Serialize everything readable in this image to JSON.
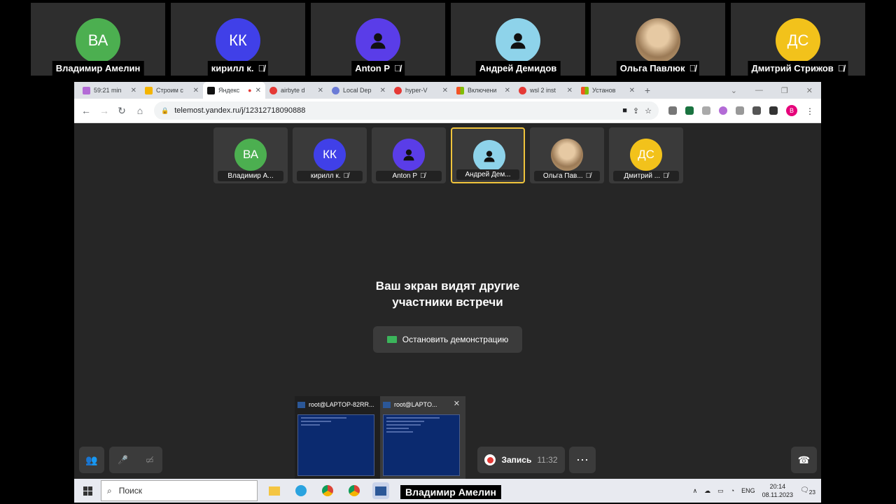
{
  "top_participants": [
    {
      "initials": "ВА",
      "name": "Владимир Амелин",
      "color": "#4caf50",
      "muted": false
    },
    {
      "initials": "КК",
      "name": "кирилл к.",
      "color": "#4040e8",
      "muted": true
    },
    {
      "initials": "",
      "name": "Anton P",
      "color": "#5a3de8",
      "muted": true,
      "icon": "person-icon"
    },
    {
      "initials": "",
      "name": "Андрей Демидов",
      "color": "#8ed3ea",
      "muted": false,
      "icon": "person-icon"
    },
    {
      "initials": "",
      "name": "Ольга Павлюк",
      "color": "#c8a77a",
      "muted": true,
      "icon": "photo-avatar"
    },
    {
      "initials": "ДС",
      "name": "Дмитрий Стрижов",
      "color": "#f2c21b",
      "muted": true
    }
  ],
  "browser": {
    "tabs": [
      {
        "title": "59:21 min",
        "color": "#b36bd6"
      },
      {
        "title": "Строим с",
        "color": "#f4b400"
      },
      {
        "title": "Яндекс",
        "color": "#111111",
        "active": true
      },
      {
        "title": "airbyte d",
        "color": "#e53935"
      },
      {
        "title": "Local Dep",
        "color": "#6b7bd6"
      },
      {
        "title": "hyper-V",
        "color": "#e53935"
      },
      {
        "title": "Включени",
        "color": "#f35325"
      },
      {
        "title": "wsl 2 inst",
        "color": "#e53935"
      },
      {
        "title": "Установ",
        "color": "#f35325"
      }
    ],
    "new_tab": "+",
    "url": "telemost.yandex.ru/j/12312718090888",
    "profile_initial": "В"
  },
  "inner_participants": [
    {
      "initials": "ВА",
      "name": "Владимир А...",
      "color": "#4caf50",
      "muted": false
    },
    {
      "initials": "КК",
      "name": "кирилл к.",
      "color": "#4040e8",
      "muted": true
    },
    {
      "initials": "",
      "name": "Anton P",
      "color": "#5a3de8",
      "muted": true
    },
    {
      "initials": "",
      "name": "Андрей Дем...",
      "color": "#8ed3ea",
      "muted": false,
      "selected": true
    },
    {
      "initials": "",
      "name": "Ольга Пав...",
      "color": "#c8a77a",
      "muted": true
    },
    {
      "initials": "ДС",
      "name": "Дмитрий ...",
      "color": "#f2c21b",
      "muted": true
    }
  ],
  "share": {
    "message_line1": "Ваш экран видят другие",
    "message_line2": "участники встречи",
    "stop_label": "Остановить демонстрацию"
  },
  "controls": {
    "record_label": "Запись",
    "record_time": "11:32",
    "more": "⋯"
  },
  "thumbnails": [
    {
      "title": "root@LAPTOP-82RR..."
    },
    {
      "title": "root@LAPTO..."
    }
  ],
  "taskbar": {
    "search_placeholder": "Поиск",
    "lang": "ENG",
    "time": "20:14",
    "date": "08.11.2023",
    "notif_count": "23"
  },
  "speaker_caption": "Владимир Амелин"
}
